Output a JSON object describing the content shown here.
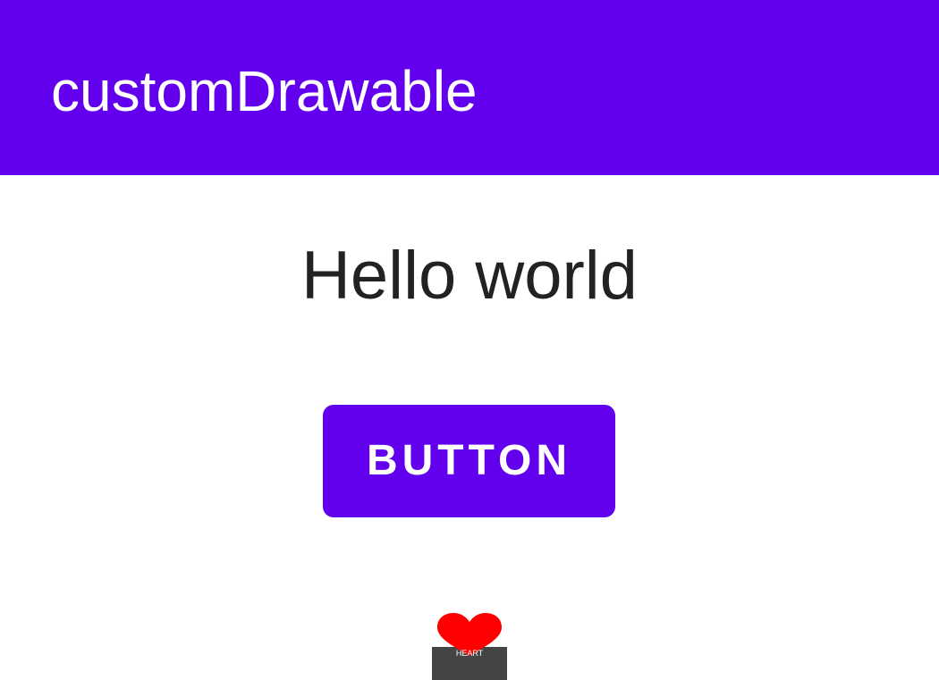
{
  "app_bar": {
    "title": "customDrawable",
    "background_color": "#6200ee"
  },
  "main": {
    "greeting": "Hello world",
    "button_label": "BUTTON",
    "button_color": "#6200ee",
    "heart": {
      "icon": "heart-icon",
      "label": "HEART",
      "color": "#ff0000"
    }
  }
}
